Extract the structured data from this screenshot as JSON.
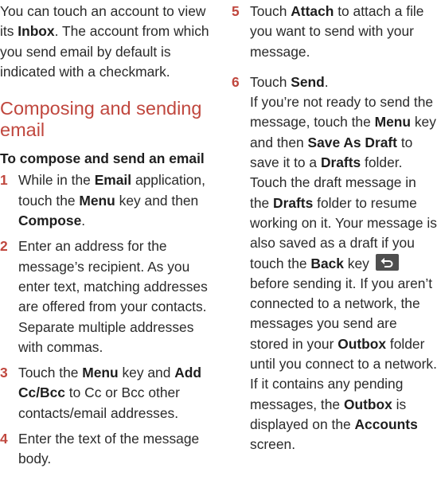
{
  "intro": {
    "t1": "You can touch an account to view its ",
    "b1": "Inbox",
    "t2": ". The account from which you send email by default is indicated with a checkmark."
  },
  "section_title": "Composing and sending email",
  "subheading": "To compose and send an email",
  "step1": {
    "num": "1",
    "t1": "While in the ",
    "b1": "Email",
    "t2": " application, touch the ",
    "b2": "Menu",
    "t3": " key and then ",
    "b3": "Compose",
    "t4": "."
  },
  "step2": {
    "num": "2",
    "text": "Enter an address for the message’s recipient. As you enter text, matching addresses are offered from your contacts. Separate multiple addresses with commas."
  },
  "step3": {
    "num": "3",
    "t1": "Touch the ",
    "b1": "Menu",
    "t2": " key and ",
    "b2": "Add Cc/Bcc",
    "t3": " to Cc or Bcc other contacts/email addresses."
  },
  "step4": {
    "num": "4",
    "text": "Enter the text of the message body."
  },
  "step5": {
    "num": "5",
    "t1": "Touch ",
    "b1": "Attach",
    "t2": " to attach a file you want to send with your message."
  },
  "step6": {
    "num": "6",
    "t1": "Touch ",
    "b1": "Send",
    "t2": ".",
    "d1": "If you’re not ready to send the message, touch the ",
    "db1": "Menu",
    "d2": " key and then ",
    "db2": "Save As Draft",
    "d3": " to save it to a ",
    "db3": "Drafts",
    "d4": " folder. Touch the draft message in the ",
    "db4": "Drafts",
    "d5": " folder to resume working on it. Your message is also saved as a draft if you touch the ",
    "db5": "Back",
    "d6": " key ",
    "d7": " before sending it. If you aren’t connected to a network, the messages you send are stored in your ",
    "db6": "Outbox",
    "d8": " folder until you connect to a network. If it contains any pending messages, the ",
    "db7": "Outbox",
    "d9": " is displayed on the ",
    "db8": "Accounts",
    "d10": " screen."
  },
  "icons": {
    "back_key": "back-arrow-icon"
  }
}
